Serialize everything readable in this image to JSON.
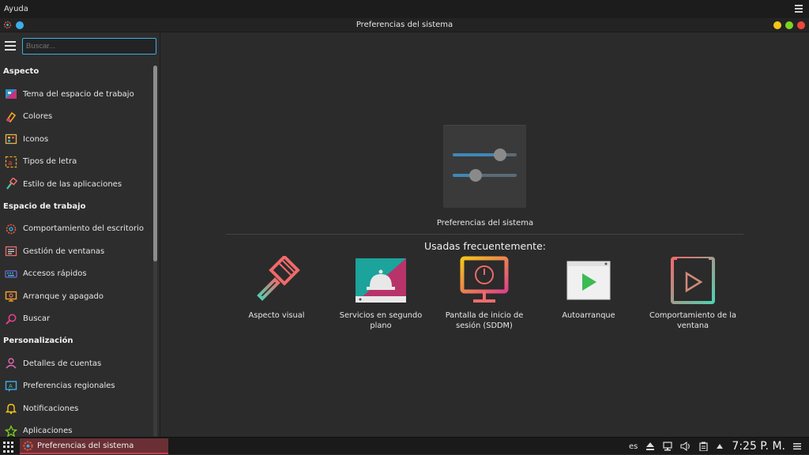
{
  "menubar": {
    "help": "Ayuda"
  },
  "window": {
    "title": "Preferencias del sistema"
  },
  "search": {
    "placeholder": "Buscar..."
  },
  "sidebar": {
    "sections": [
      {
        "title": "Aspecto",
        "items": [
          {
            "label": "Tema del espacio de trabajo",
            "icon": "workspace-theme-icon"
          },
          {
            "label": "Colores",
            "icon": "colors-icon"
          },
          {
            "label": "Iconos",
            "icon": "icons-icon"
          },
          {
            "label": "Tipos de letra",
            "icon": "fonts-icon"
          },
          {
            "label": "Estilo de las aplicaciones",
            "icon": "app-style-icon"
          }
        ]
      },
      {
        "title": "Espacio de trabajo",
        "items": [
          {
            "label": "Comportamiento del escritorio",
            "icon": "desktop-behavior-icon"
          },
          {
            "label": "Gestión de ventanas",
            "icon": "window-management-icon"
          },
          {
            "label": "Accesos rápidos",
            "icon": "shortcuts-icon"
          },
          {
            "label": "Arranque y apagado",
            "icon": "startup-shutdown-icon"
          },
          {
            "label": "Buscar",
            "icon": "search-icon"
          }
        ]
      },
      {
        "title": "Personalización",
        "items": [
          {
            "label": "Detalles de cuentas",
            "icon": "account-details-icon"
          },
          {
            "label": "Preferencias regionales",
            "icon": "regional-icon"
          },
          {
            "label": "Notificaciones",
            "icon": "notifications-icon"
          },
          {
            "label": "Aplicaciones",
            "icon": "applications-icon"
          }
        ]
      }
    ]
  },
  "main": {
    "hero_label": "Preferencias del sistema",
    "frequent_title": "Usadas frecuentemente:",
    "frequent": [
      {
        "label": "Aspecto visual"
      },
      {
        "label": "Servicios en segundo plano"
      },
      {
        "label": "Pantalla de inicio de sesión (SDDM)"
      },
      {
        "label": "Autoarranque"
      },
      {
        "label": "Comportamiento de la ventana"
      }
    ]
  },
  "taskbar": {
    "task_label": "Preferencias del sistema",
    "lang": "es",
    "clock": "7:25 P. M."
  },
  "colors": {
    "accent": "#3daee9",
    "task_bg": "#6a2f34"
  }
}
